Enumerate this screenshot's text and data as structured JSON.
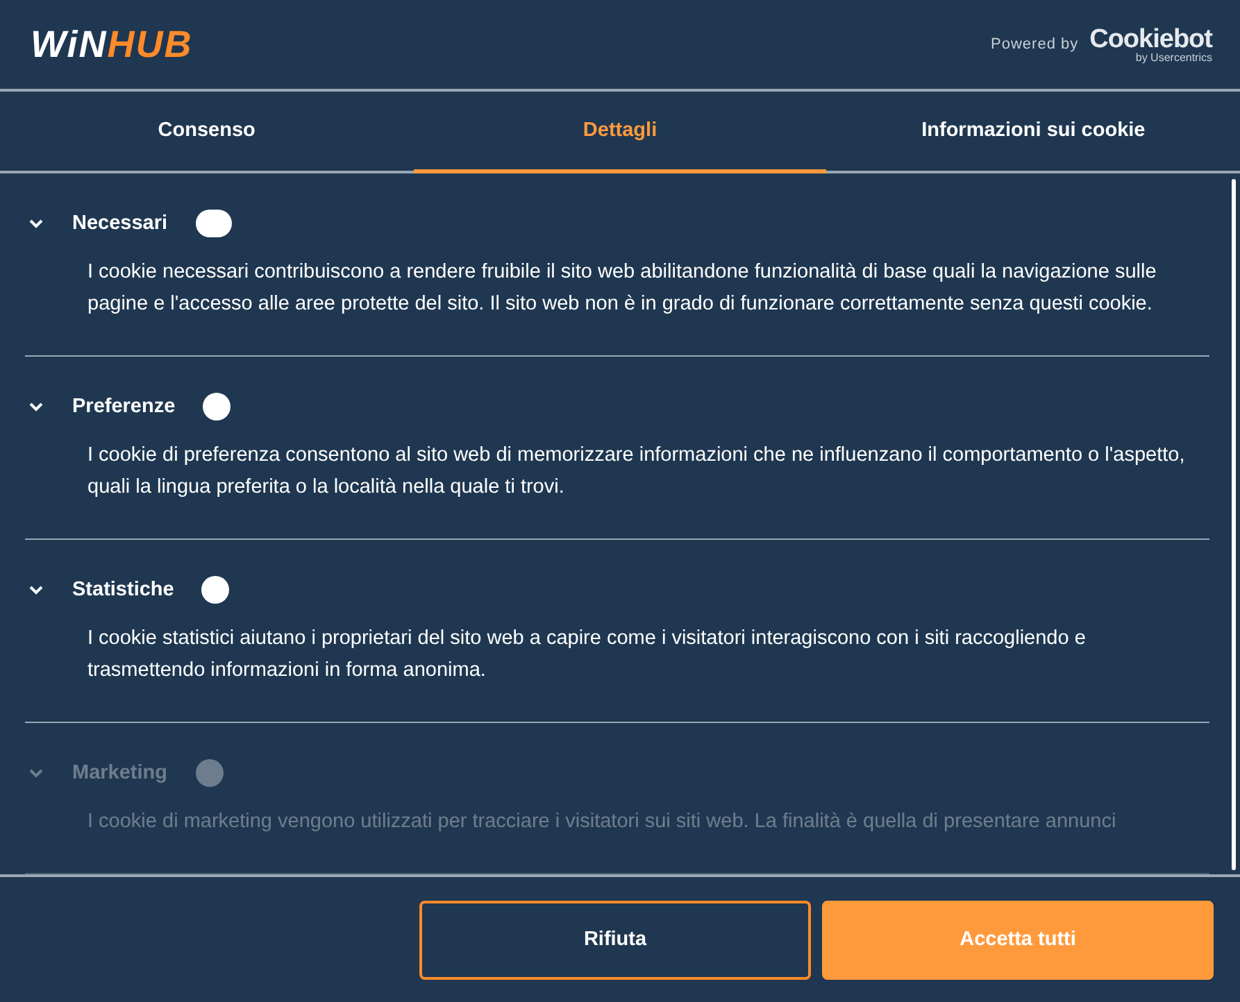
{
  "header": {
    "logo": {
      "first": "WiN",
      "second": "HUB"
    },
    "powered_by": "Powered by",
    "brand": "Cookiebot",
    "brand_sub": "by Usercentrics"
  },
  "tabs": [
    {
      "label": "Consenso",
      "selected": false
    },
    {
      "label": "Dettagli",
      "selected": true
    },
    {
      "label": "Informazioni sui cookie",
      "selected": false
    }
  ],
  "sections": [
    {
      "title": "Necessari",
      "expanded": true,
      "faded": false,
      "description": "I cookie necessari contribuiscono a rendere fruibile il sito web abilitandone funzionalità di base quali la navigazione sulle pagine e l'accesso alle aree protette del sito. Il sito web non è in grado di funzionare correttamente senza questi cookie."
    },
    {
      "title": "Preferenze",
      "expanded": true,
      "faded": false,
      "description": "I cookie di preferenza consentono al sito web di memorizzare informazioni che ne influenzano il comportamento o l'aspetto, quali la lingua preferita o la località nella quale ti trovi."
    },
    {
      "title": "Statistiche",
      "expanded": true,
      "faded": false,
      "description": "I cookie statistici aiutano i proprietari del sito web a capire come i visitatori interagiscono con i siti raccogliendo e trasmettendo informazioni in forma anonima."
    },
    {
      "title": "Marketing",
      "expanded": true,
      "faded": true,
      "description": "I cookie di marketing vengono utilizzati per tracciare i visitatori sui siti web. La finalità è quella di presentare annunci"
    }
  ],
  "buttons": [
    {
      "label": "Rifiuta",
      "kind": "outline"
    },
    {
      "label": "Accetta tutti",
      "kind": "primary"
    }
  ]
}
